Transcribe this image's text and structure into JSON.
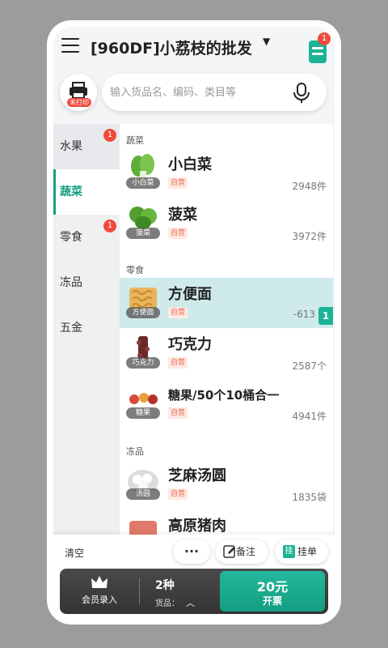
{
  "header": {
    "title": "[960DF]小荔枝的批发...",
    "caret": "▼",
    "cart_badge": "1"
  },
  "printer": {
    "tag": "未打印"
  },
  "search": {
    "placeholder": "输入货品名、编码、类目等"
  },
  "categories": [
    {
      "label": "水果",
      "badge": "1"
    },
    {
      "label": "蔬菜",
      "badge": ""
    },
    {
      "label": "零食",
      "badge": "1"
    },
    {
      "label": "冻品",
      "badge": ""
    },
    {
      "label": "五金",
      "badge": ""
    }
  ],
  "sections": {
    "veg": "蔬菜",
    "snack": "零食",
    "frozen": "冻品"
  },
  "products": [
    {
      "name": "小白菜",
      "thumb_label": "小白菜",
      "tag": "自营",
      "stock": "2948件"
    },
    {
      "name": "菠菜",
      "thumb_label": "菠菜",
      "tag": "自营",
      "stock": "3972件"
    },
    {
      "name": "方便面",
      "thumb_label": "方便面",
      "tag": "自营",
      "stock": "-613",
      "qty": "1"
    },
    {
      "name": "巧克力",
      "thumb_label": "巧克力",
      "tag": "自营",
      "stock": "2587个"
    },
    {
      "name": "糖果/50个10桶合一",
      "thumb_label": "糖果",
      "tag": "自营",
      "stock": "4941件"
    },
    {
      "name": "芝麻汤圆",
      "thumb_label": "汤圆",
      "tag": "自营",
      "stock": "1835袋"
    },
    {
      "name": "高原猪肉",
      "thumb_label": "",
      "tag": "",
      "stock": ""
    }
  ],
  "bottom": {
    "clear": "清空",
    "more": "···",
    "note": "备注",
    "hold": "挂单",
    "hold_icon": "挂",
    "member": "会员录入",
    "kinds": "2种",
    "goods": "货品：",
    "chevron": "︿",
    "amount": "20元",
    "checkout": "开票"
  },
  "colors": {
    "accent": "#1bb394",
    "badge": "#ef4b3c"
  }
}
